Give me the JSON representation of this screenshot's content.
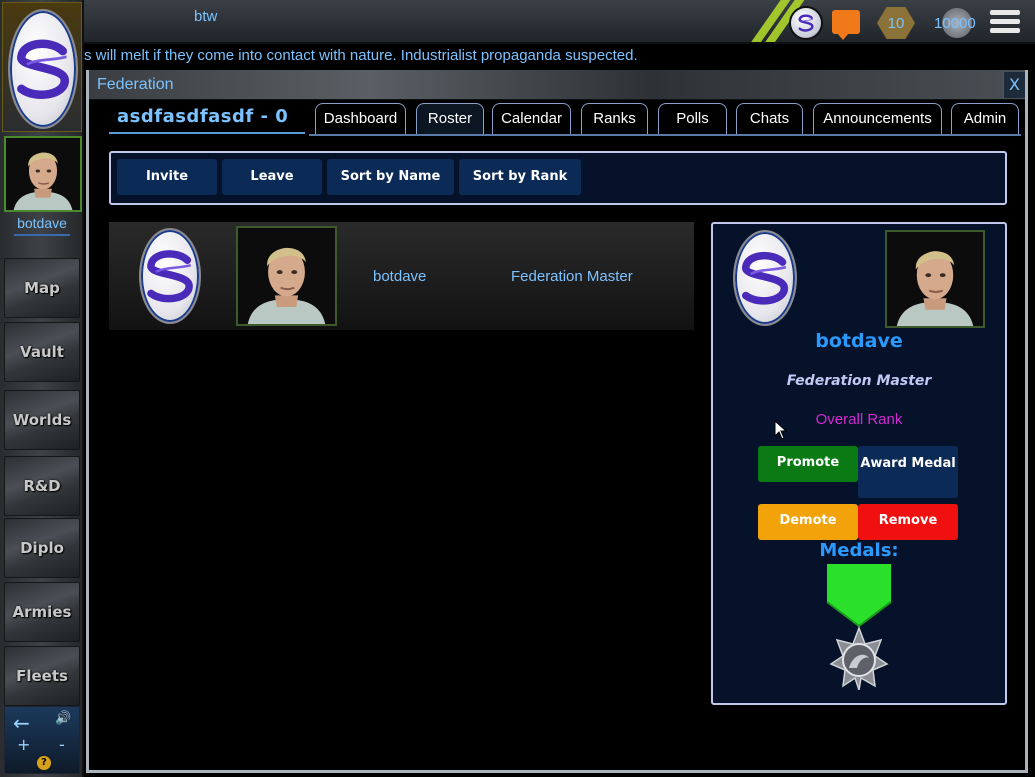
{
  "sidebar": {
    "username": "botdave",
    "nav": [
      {
        "label": "Map"
      },
      {
        "label": "Vault"
      },
      {
        "label": "Worlds"
      },
      {
        "label": "R&D"
      },
      {
        "label": "Diplo"
      },
      {
        "label": "Armies"
      },
      {
        "label": "Fleets"
      }
    ],
    "footer": {
      "back_symbol": "←",
      "sound_symbol": "🔊",
      "plus_symbol": "+",
      "minus_symbol": "-",
      "help_symbol": "?"
    }
  },
  "topbar": {
    "chat_text": "btw",
    "level": "10",
    "credits": "10000",
    "icons": [
      "s-coin-icon",
      "message-icon",
      "level-badge-icon",
      "credits-coin-icon",
      "menu-icon"
    ]
  },
  "ticker": {
    "text": "s will melt if they come into contact with nature. Industrialist propaganda suspected."
  },
  "federation": {
    "window_title": "Federation",
    "close_label": "X",
    "name": "asdfasdfasdf - 0",
    "tabs": [
      {
        "label": "Dashboard"
      },
      {
        "label": "Roster",
        "active": true
      },
      {
        "label": "Calendar"
      },
      {
        "label": "Ranks"
      },
      {
        "label": "Polls"
      },
      {
        "label": "Chats"
      },
      {
        "label": "Announcements"
      },
      {
        "label": "Admin"
      }
    ],
    "actions": [
      {
        "label": "Invite"
      },
      {
        "label": "Leave"
      },
      {
        "label": "Sort by Name"
      },
      {
        "label": "Sort by Rank"
      }
    ],
    "roster": [
      {
        "name": "botdave",
        "rank": "Federation Master"
      }
    ],
    "detail": {
      "name": "botdave",
      "rank": "Federation Master",
      "overall_rank_label": "Overall Rank",
      "promote_label": "Promote",
      "award_medal_label": "Award Medal",
      "demote_label": "Demote",
      "remove_label": "Remove",
      "medals_heading": "Medals:"
    }
  },
  "colors": {
    "accent_blue": "#7cc2ff",
    "name_blue": "#2a9aff",
    "promote_green": "#0b7a14",
    "demote_orange": "#f2a30a",
    "remove_red": "#f01010",
    "overall_rank_magenta": "#d22ad2",
    "medal_ribbon": "#2ae02a"
  }
}
